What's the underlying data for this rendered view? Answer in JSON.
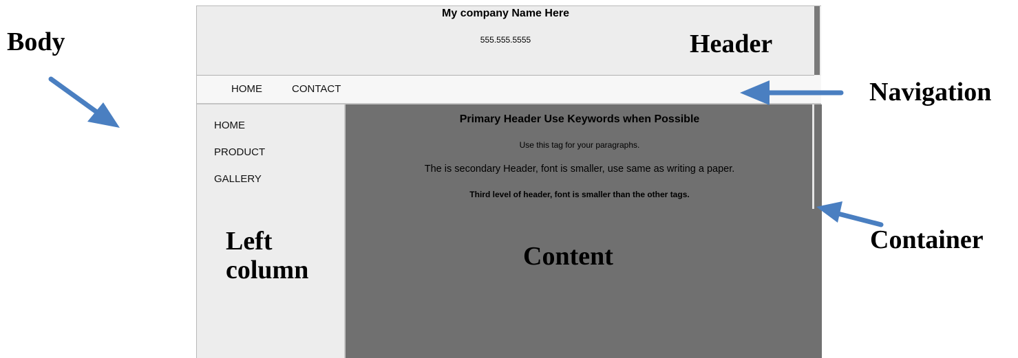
{
  "labels": {
    "body": "Body",
    "header": "Header",
    "navigation": "Navigation",
    "left_column_line1": "Left",
    "left_column_line2": "column",
    "content": "Content",
    "container": "Container"
  },
  "header": {
    "company_name": "My company Name Here",
    "phone": "555.555.5555"
  },
  "nav": {
    "items": [
      "HOME",
      "CONTACT"
    ]
  },
  "sidebar": {
    "items": [
      "HOME",
      "PRODUCT",
      "GALLERY"
    ]
  },
  "content": {
    "primary_header": "Primary Header Use Keywords when Possible",
    "paragraph": "Use this tag for your paragraphs.",
    "secondary_header": "The is secondary Header, font is smaller, use same as writing a paper.",
    "third_header": "Third level of header, font is smaller than the other tags."
  },
  "colors": {
    "arrow": "#4a7fc1",
    "content_bg": "#707070",
    "panel_bg": "#ededed",
    "nav_bg": "#f7f7f7"
  }
}
